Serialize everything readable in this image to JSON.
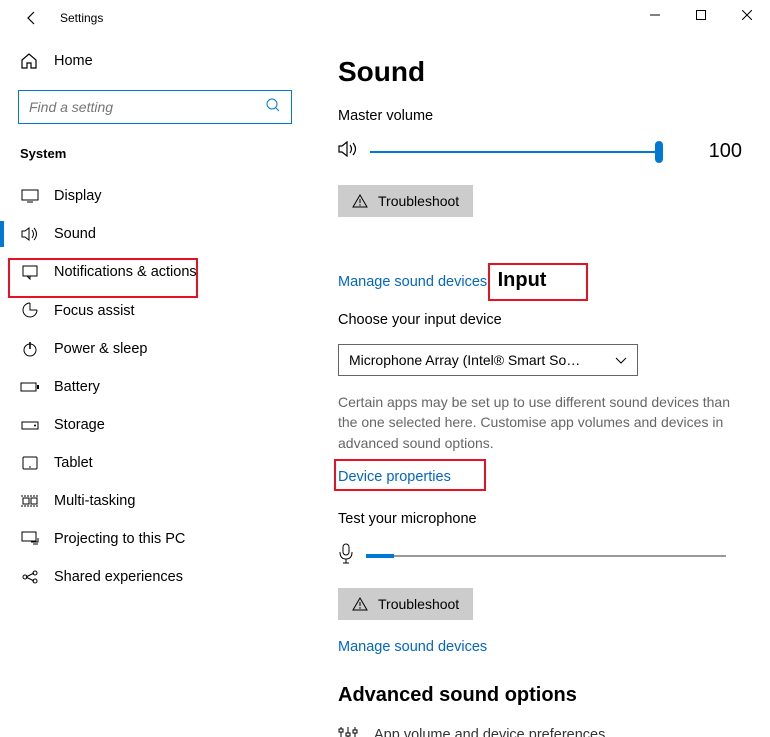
{
  "titlebar": {
    "title": "Settings"
  },
  "sidebar": {
    "home": "Home",
    "search_placeholder": "Find a setting",
    "section": "System",
    "items": [
      {
        "label": "Display"
      },
      {
        "label": "Sound"
      },
      {
        "label": "Notifications & actions"
      },
      {
        "label": "Focus assist"
      },
      {
        "label": "Power & sleep"
      },
      {
        "label": "Battery"
      },
      {
        "label": "Storage"
      },
      {
        "label": "Tablet"
      },
      {
        "label": "Multi-tasking"
      },
      {
        "label": "Projecting to this PC"
      },
      {
        "label": "Shared experiences"
      }
    ]
  },
  "main": {
    "title": "Sound",
    "master_volume_label": "Master volume",
    "volume_value": "100",
    "troubleshoot": "Troubleshoot",
    "manage_link": "Manage sound devices",
    "input_heading": "Input",
    "choose_input_label": "Choose your input device",
    "input_device": "Microphone Array (Intel® Smart So…",
    "input_helper": "Certain apps may be set up to use different sound devices than the one selected here. Customise app volumes and devices in advanced sound options.",
    "device_properties": "Device properties",
    "test_mic": "Test your microphone",
    "advanced_heading": "Advanced sound options",
    "advanced_item": "App volume and device preferences"
  }
}
